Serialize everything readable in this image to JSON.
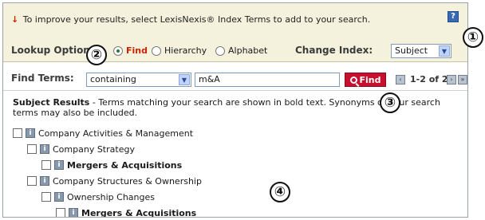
{
  "hint": {
    "arrow": "↓",
    "text": "To improve your results, select LexisNexis® Index Terms to add to your search.",
    "help_label": "?"
  },
  "lookup": {
    "label": "Lookup Options:",
    "options": [
      {
        "label": "Find",
        "selected": true
      },
      {
        "label": "Hierarchy",
        "selected": false
      },
      {
        "label": "Alphabet",
        "selected": false
      }
    ],
    "change_index_label": "Change Index:",
    "index_value": "Subject"
  },
  "find": {
    "label": "Find Terms:",
    "mode_value": "containing",
    "query_value": "m&A",
    "button_label": "Find",
    "pager_text": "1-2 of 2",
    "prev_label": "‹",
    "next_label": "›",
    "last_label": "»"
  },
  "results": {
    "title": "Subject Results",
    "description": " - Terms matching your search are shown in bold text. Synonyms of your search terms may also be included.",
    "items": [
      {
        "label": "Company Activities & Management",
        "bold": false
      },
      {
        "label": "Company Strategy",
        "bold": false
      },
      {
        "label": "Mergers & Acquisitions",
        "bold": true
      },
      {
        "label": "Company Structures & Ownership",
        "bold": false
      },
      {
        "label": "Ownership Changes",
        "bold": false
      },
      {
        "label": "Mergers & Acquisitions",
        "bold": true
      }
    ],
    "info_label": "i"
  },
  "callouts": [
    "①",
    "②",
    "③",
    "④"
  ],
  "colors": {
    "hint_background": "#f4f1dc",
    "find_button": "#c8102e",
    "selected_radio_text": "#cc2200",
    "help_button": "#3a69b3"
  }
}
